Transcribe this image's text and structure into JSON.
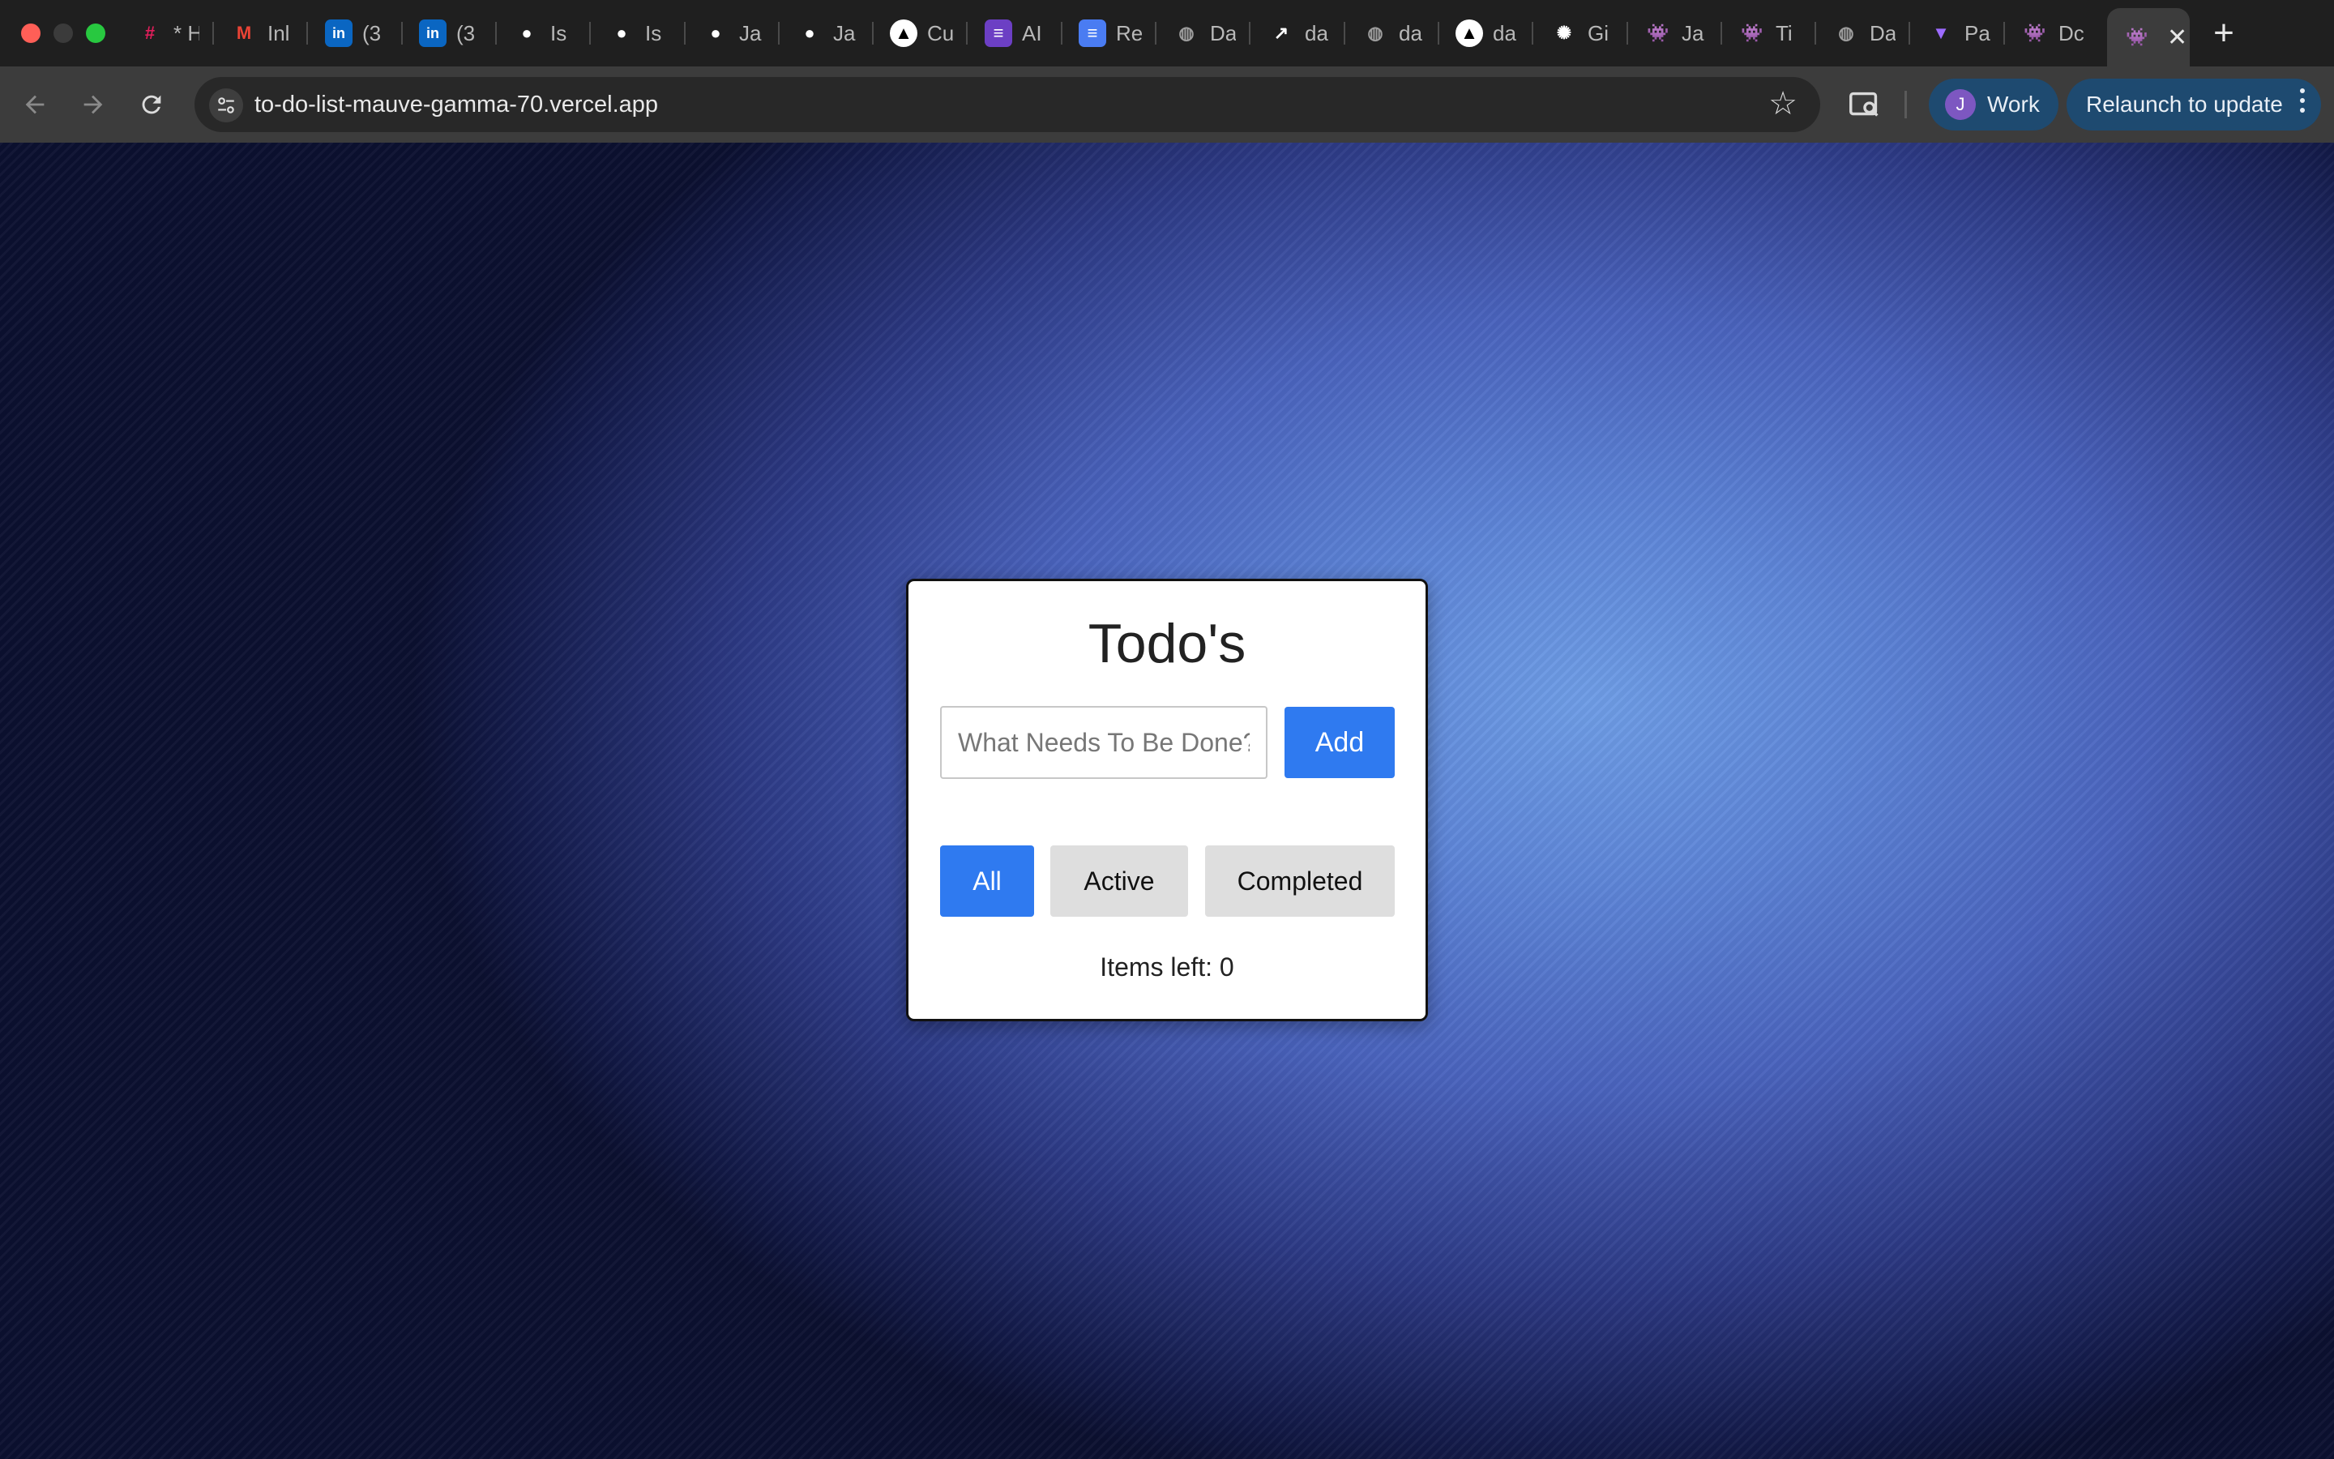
{
  "browser": {
    "tabs": [
      {
        "title": "* H",
        "icon": "slack-icon",
        "color": "#e01e5a"
      },
      {
        "title": "Inl",
        "icon": "gmail-icon",
        "color": "#ea4335"
      },
      {
        "title": "(3",
        "icon": "linkedin-icon",
        "color": "#0a66c2"
      },
      {
        "title": "(3",
        "icon": "linkedin-icon",
        "color": "#0a66c2"
      },
      {
        "title": "Is",
        "icon": "github-icon",
        "color": "#ffffff"
      },
      {
        "title": "Is",
        "icon": "github-icon",
        "color": "#ffffff"
      },
      {
        "title": "Ja",
        "icon": "github-icon",
        "color": "#ffffff"
      },
      {
        "title": "Ja",
        "icon": "github-icon",
        "color": "#ffffff"
      },
      {
        "title": "Cu",
        "icon": "cursor-icon",
        "color": "#000000"
      },
      {
        "title": "AI",
        "icon": "list-icon",
        "color": "#6c3fc4"
      },
      {
        "title": "Re",
        "icon": "docs-icon",
        "color": "#4a7cf2"
      },
      {
        "title": "Da",
        "icon": "globe-icon",
        "color": "#9e9e9e"
      },
      {
        "title": "da",
        "icon": "flow-icon",
        "color": "#ffffff"
      },
      {
        "title": "da",
        "icon": "globe-icon",
        "color": "#9e9e9e"
      },
      {
        "title": "da",
        "icon": "vercel-icon",
        "color": "#000000"
      },
      {
        "title": "Gi",
        "icon": "openai-icon",
        "color": "#ffffff"
      },
      {
        "title": "Ja",
        "icon": "alien-icon",
        "color": "#7a4fd6"
      },
      {
        "title": "Ti",
        "icon": "alien-icon",
        "color": "#7a4fd6"
      },
      {
        "title": "Da",
        "icon": "globe-icon",
        "color": "#9e9e9e"
      },
      {
        "title": "Pa",
        "icon": "vite-icon",
        "color": "#9c6bff"
      },
      {
        "title": "Dc",
        "icon": "alien-icon",
        "color": "#7a4fd6"
      },
      {
        "title": "",
        "icon": "alien-icon",
        "color": "#7a4fd6",
        "active": true
      }
    ],
    "url": "to-do-list-mauve-gamma-70.vercel.app",
    "profile": {
      "initial": "J",
      "label": "Work"
    },
    "relaunch_label": "Relaunch to update"
  },
  "app": {
    "title": "Todo's",
    "input_placeholder": "What Needs To Be Done?",
    "input_value": "",
    "add_label": "Add",
    "filters": {
      "all": "All",
      "active": "Active",
      "completed": "Completed",
      "selected": "all"
    },
    "items_left": "Items left: 0"
  },
  "colors": {
    "accent": "#2f7af0",
    "filter_inactive": "#dedede"
  }
}
